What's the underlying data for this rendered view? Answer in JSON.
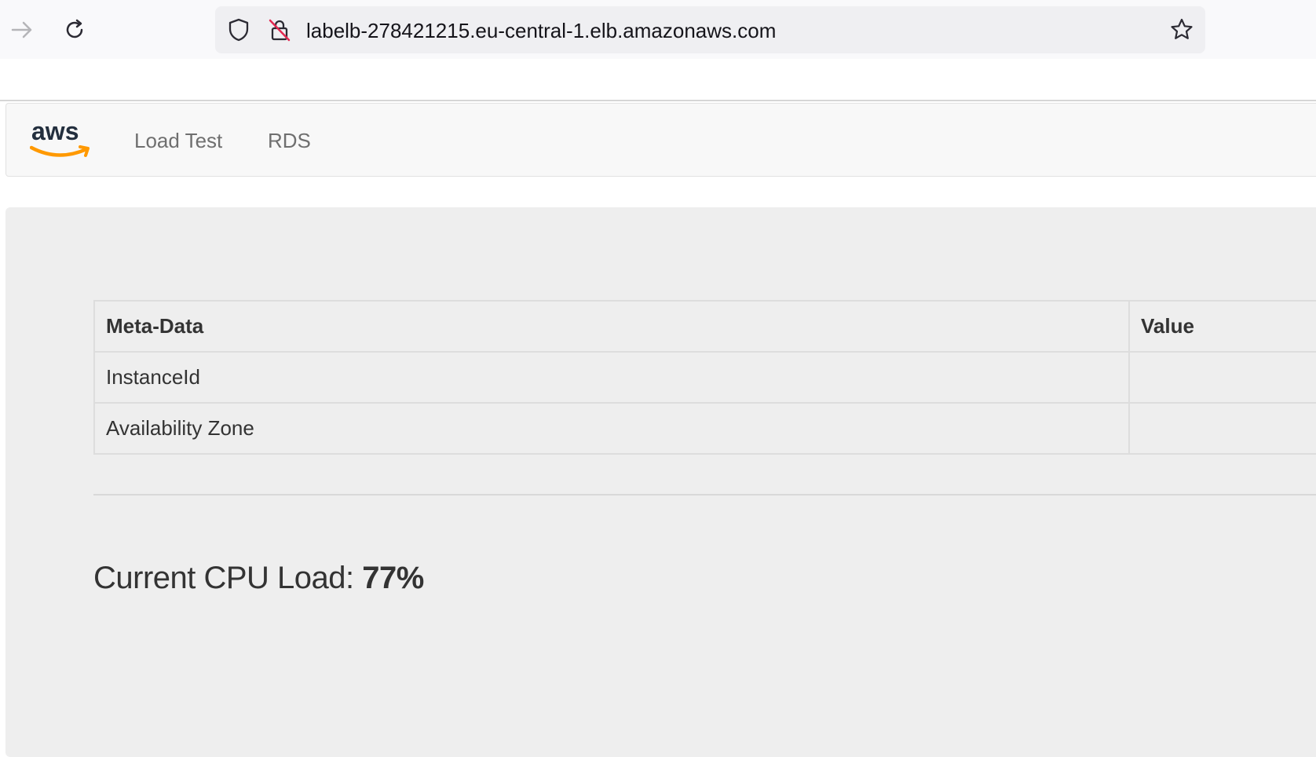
{
  "browser": {
    "url": "labelb-278421215.eu-central-1.elb.amazonaws.com",
    "icons": [
      "forward-arrow-icon",
      "reload-icon",
      "shield-icon",
      "insecure-lock-icon",
      "bookmark-star-icon"
    ]
  },
  "navbar": {
    "logo_text": "aws",
    "links": [
      {
        "label": "Load Test"
      },
      {
        "label": "RDS"
      }
    ]
  },
  "table": {
    "headers": [
      "Meta-Data",
      "Value"
    ],
    "rows": [
      {
        "key": "InstanceId",
        "value": ""
      },
      {
        "key": "Availability Zone",
        "value": ""
      }
    ]
  },
  "cpu": {
    "label": "Current CPU Load:",
    "value": "77%"
  },
  "colors": {
    "aws_orange": "#ff9900",
    "aws_text": "#232f3e",
    "insecure_red": "#e22850"
  }
}
